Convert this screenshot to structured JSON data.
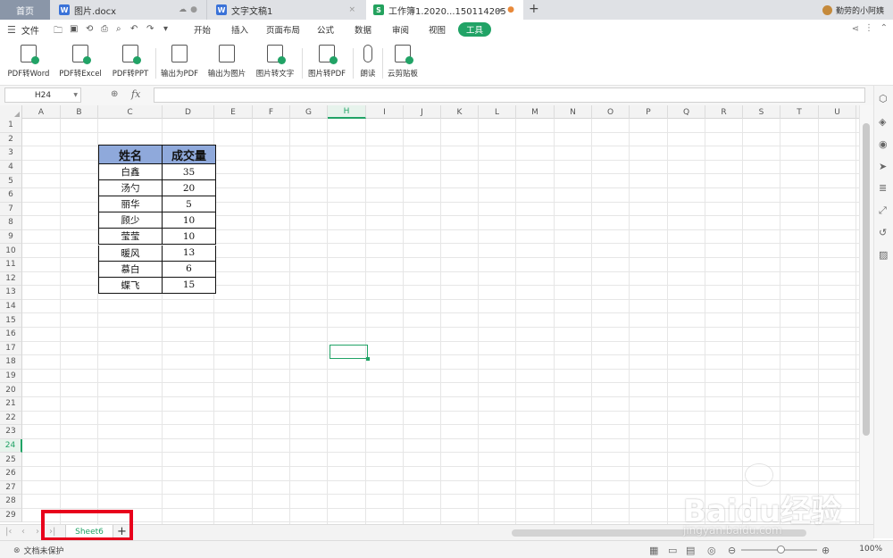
{
  "tabs": {
    "home": "首页",
    "doc1": "图片.docx",
    "doc2": "文字文稿1",
    "workbook": "工作簿1.2020...150114205",
    "new_tab": "+",
    "user_name": "勤劳的小阿姨"
  },
  "menubar": {
    "file": "文件",
    "items": [
      "开始",
      "插入",
      "页面布局",
      "公式",
      "数据",
      "审阅",
      "视图",
      "工具"
    ],
    "active": "工具"
  },
  "ribbon": {
    "buttons": [
      "PDF转Word",
      "PDF转Excel",
      "PDF转PPT",
      "输出为PDF",
      "输出为图片",
      "图片转文字",
      "图片转PDF",
      "朗读",
      "云剪贴板"
    ]
  },
  "formula_bar": {
    "name_box": "H24",
    "fx": "fx",
    "value": ""
  },
  "grid": {
    "columns": [
      "A",
      "B",
      "C",
      "D",
      "E",
      "F",
      "G",
      "H",
      "I",
      "J",
      "K",
      "L",
      "M",
      "N",
      "O",
      "P",
      "Q",
      "R",
      "S",
      "T",
      "U"
    ],
    "rows": [
      "1",
      "2",
      "3",
      "4",
      "5",
      "6",
      "7",
      "8",
      "9",
      "10",
      "11",
      "12",
      "13",
      "14",
      "15",
      "16",
      "17",
      "18",
      "19",
      "20",
      "21",
      "22",
      "23",
      "24",
      "25",
      "26",
      "27",
      "28",
      "29"
    ],
    "selected_col": "H",
    "selected_row": "24"
  },
  "table": {
    "headers": [
      "姓名",
      "成交量"
    ],
    "rows": [
      [
        "白鑫",
        "35"
      ],
      [
        "汤勺",
        "20"
      ],
      [
        "丽华",
        "5"
      ],
      [
        "顾少",
        "10"
      ],
      [
        "莹莹",
        "10"
      ],
      [
        "暖风",
        "13"
      ],
      [
        "慕白",
        "6"
      ],
      [
        "蝶飞",
        "15"
      ]
    ]
  },
  "sheets": {
    "active": "Sheet6",
    "add": "+"
  },
  "status": {
    "protect": "文档未保护",
    "zoom": "100%"
  },
  "watermark": {
    "brand": "Baidu经验",
    "url": "jingyan.baidu.com"
  },
  "colors": {
    "accent": "#21a366",
    "header_fill": "#8fa9db",
    "highlight_box": "#e8001c"
  }
}
